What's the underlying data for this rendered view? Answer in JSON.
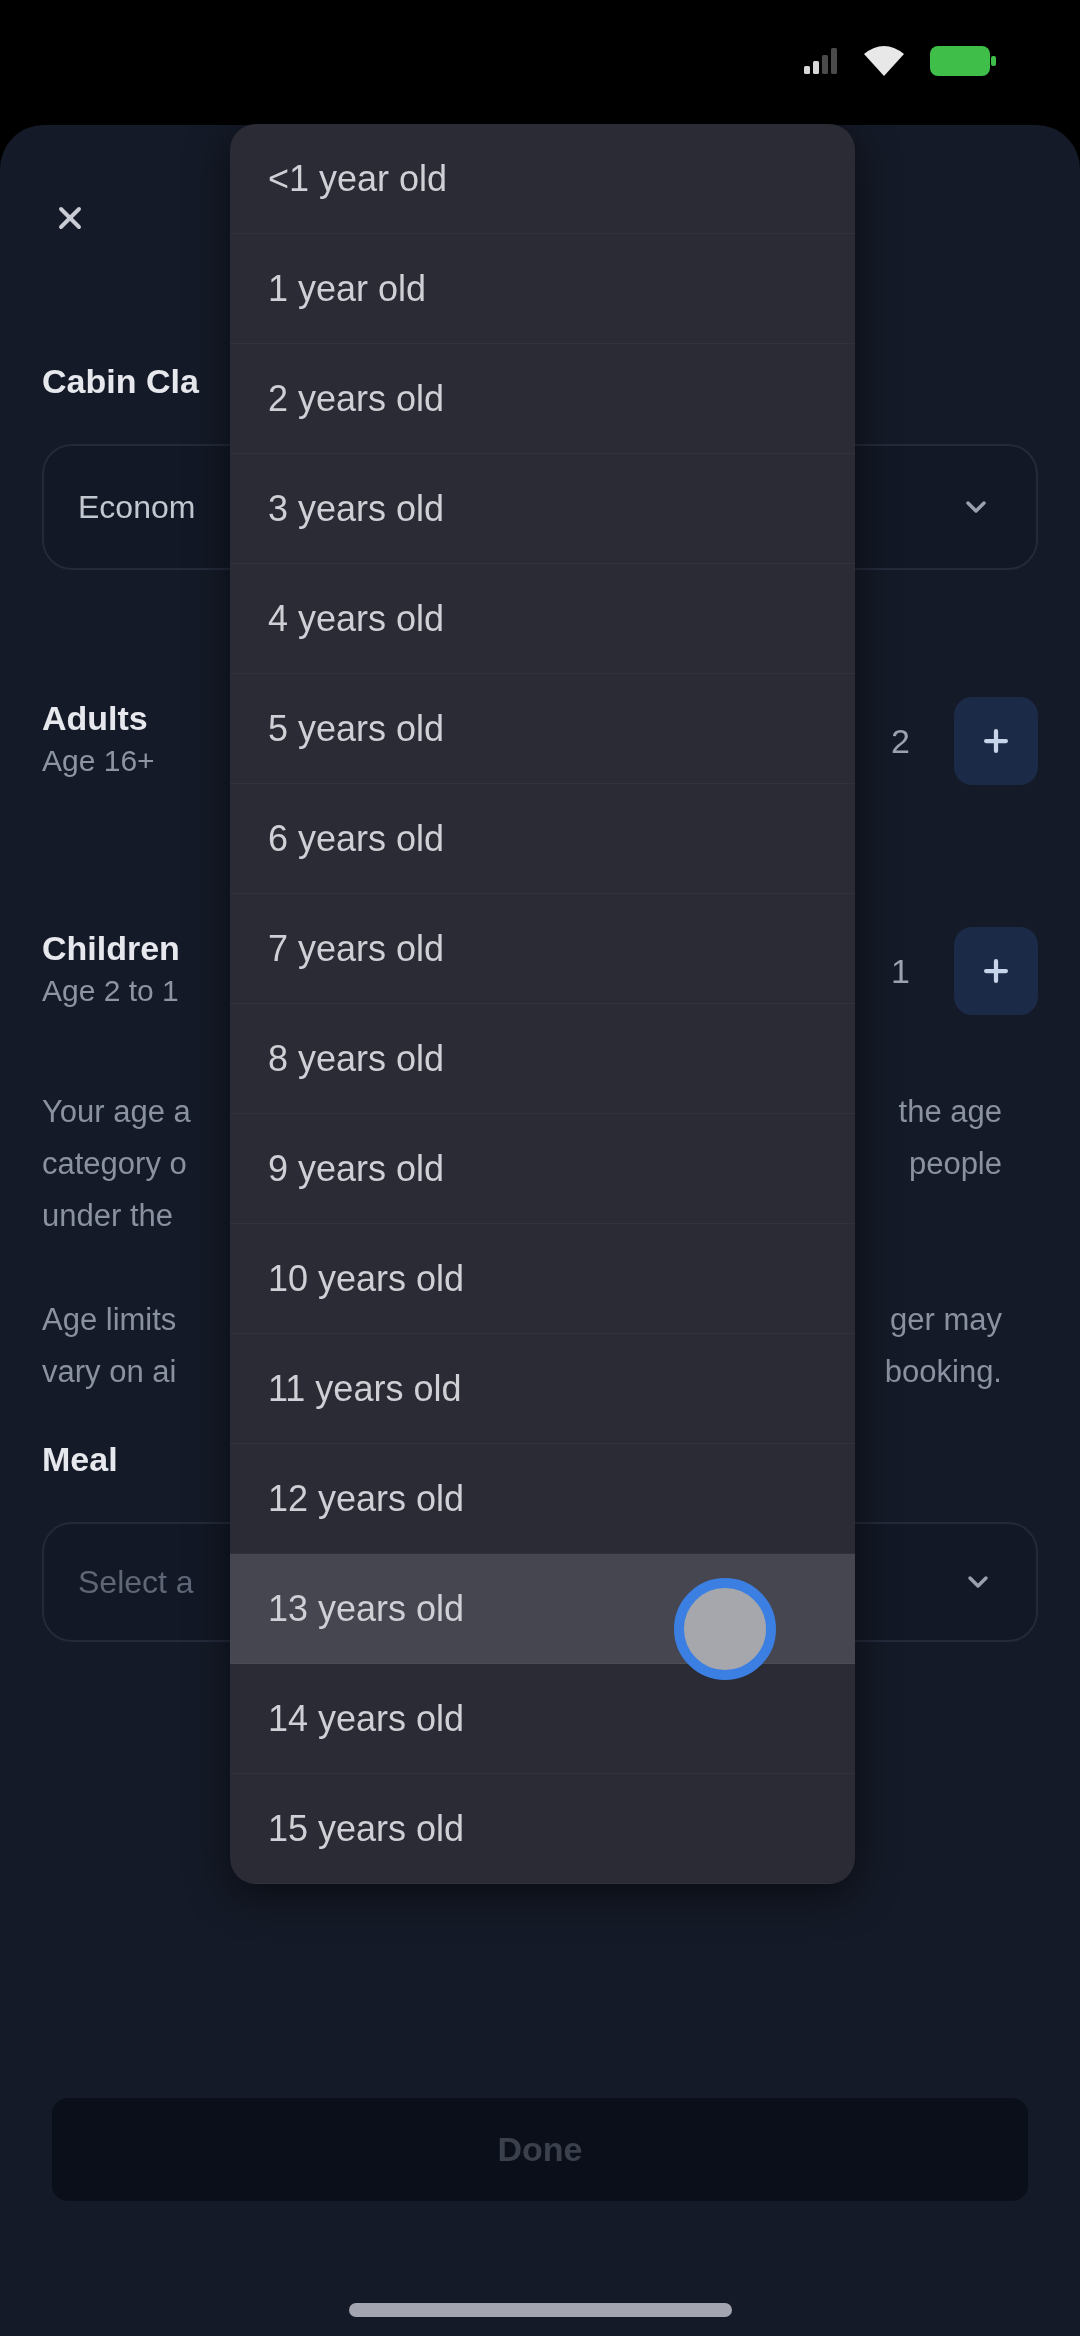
{
  "cabin_class": {
    "label": "Cabin Cla",
    "value": "Econom"
  },
  "passengers": [
    {
      "label": "Adults",
      "hint": "Age 16+",
      "count": "2"
    },
    {
      "label": "Children",
      "hint": "Age 2 to 1",
      "count": "1"
    }
  ],
  "notes": [
    {
      "lines": [
        {
          "start": "Your age a",
          "end": "the age"
        },
        {
          "start": "category o",
          "end": "people"
        },
        {
          "start": "under the"
        }
      ]
    },
    {
      "lines": [
        {
          "start": "Age limits",
          "end": "ger may"
        },
        {
          "start": "vary on ai",
          "end": "booking."
        }
      ]
    }
  ],
  "meal": {
    "label": "Meal",
    "placeholder": "Select a"
  },
  "done_button": {
    "label": "Done",
    "disabled": true
  },
  "age_menu": {
    "items": [
      {
        "label": "<1 year old",
        "selected": false
      },
      {
        "label": "1 year old",
        "selected": false
      },
      {
        "label": "2 years old",
        "selected": false
      },
      {
        "label": "3 years old",
        "selected": false
      },
      {
        "label": "4 years old",
        "selected": false
      },
      {
        "label": "5 years old",
        "selected": false
      },
      {
        "label": "6 years old",
        "selected": false
      },
      {
        "label": "7 years old",
        "selected": false
      },
      {
        "label": "8 years old",
        "selected": false
      },
      {
        "label": "9 years old",
        "selected": false
      },
      {
        "label": "10 years old",
        "selected": false
      },
      {
        "label": "11 years old",
        "selected": false
      },
      {
        "label": "12 years old",
        "selected": false
      },
      {
        "label": "13 years old",
        "selected": true
      },
      {
        "label": "14 years old",
        "selected": false
      },
      {
        "label": "15 years old",
        "selected": false
      }
    ]
  }
}
